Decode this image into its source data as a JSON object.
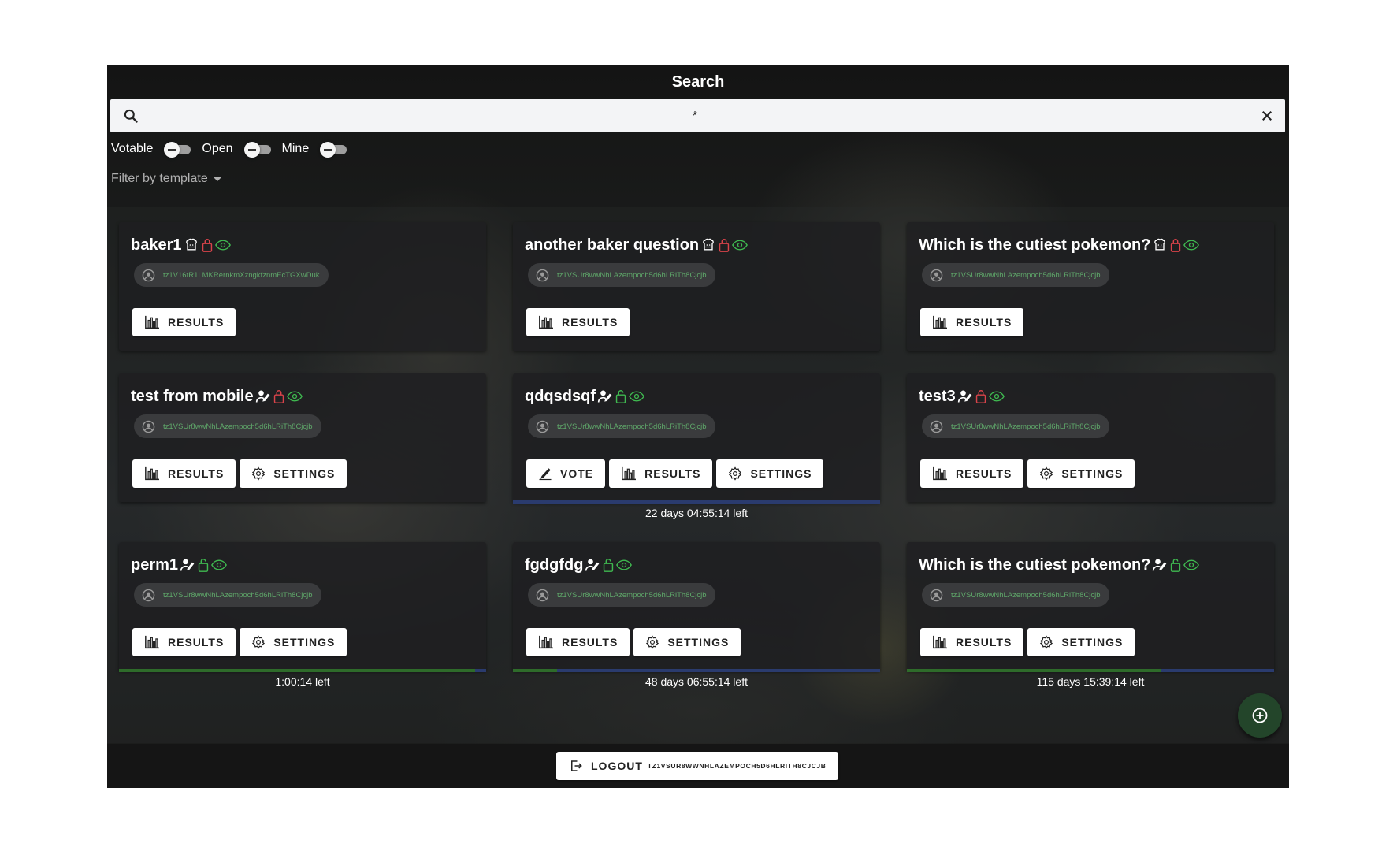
{
  "header": {
    "title": "Search"
  },
  "search": {
    "value": "*",
    "placeholder": ""
  },
  "filters": {
    "toggles": [
      {
        "label": "Votable",
        "checked": false
      },
      {
        "label": "Open",
        "checked": false
      },
      {
        "label": "Mine",
        "checked": false
      }
    ],
    "template_label": "Filter by template"
  },
  "buttons": {
    "vote": "VOTE",
    "results": "RESULTS",
    "settings": "SETTINGS"
  },
  "cards": [
    {
      "title": "baker1",
      "owner": "tz1V16tR1LMKRernkmXzngkfznmEcTGXwDuk",
      "type_icon": "baker-icon",
      "lock_icon": "lock-closed-icon"
    },
    {
      "title": "another baker question",
      "owner": "tz1VSUr8wwNhLAzempoch5d6hLRiTh8Cjcjb",
      "type_icon": "baker-icon",
      "lock_icon": "lock-closed-icon"
    },
    {
      "title": "Which is the cutiest pokemon?",
      "owner": "tz1VSUr8wwNhLAzempoch5d6hLRiTh8Cjcjb",
      "type_icon": "baker-icon",
      "lock_icon": "lock-closed-icon"
    },
    {
      "title": "test from mobile",
      "owner": "tz1VSUr8wwNhLAzempoch5d6hLRiTh8Cjcjb",
      "type_icon": "voter-icon",
      "lock_icon": "lock-closed-icon"
    },
    {
      "title": "qdqsdsqf",
      "owner": "tz1VSUr8wwNhLAzempoch5d6hLRiTh8Cjcjb",
      "type_icon": "voter-icon",
      "lock_icon": "lock-open-icon",
      "time_left": "22 days 04:55:14 left",
      "progress": 0
    },
    {
      "title": "test3",
      "owner": "tz1VSUr8wwNhLAzempoch5d6hLRiTh8Cjcjb",
      "type_icon": "voter-icon",
      "lock_icon": "lock-closed-icon"
    },
    {
      "title": "perm1",
      "owner": "tz1VSUr8wwNhLAzempoch5d6hLRiTh8Cjcjb",
      "type_icon": "voter-icon",
      "lock_icon": "lock-open-icon",
      "time_left": "1:00:14 left",
      "progress": 0.97
    },
    {
      "title": "fgdgfdg",
      "owner": "tz1VSUr8wwNhLAzempoch5d6hLRiTh8Cjcjb",
      "type_icon": "voter-icon",
      "lock_icon": "lock-open-icon",
      "time_left": "48 days 06:55:14 left",
      "progress": 0.12
    },
    {
      "title": "Which is the cutiest pokemon?",
      "owner": "tz1VSUr8wwNhLAzempoch5d6hLRiTh8Cjcjb",
      "type_icon": "voter-icon",
      "lock_icon": "lock-open-icon",
      "time_left": "115 days 15:39:14 left",
      "progress": 0.69
    }
  ],
  "footer": {
    "logout_label": "LOGOUT",
    "address": "TZ1VSUR8WWNHLAZEMPOCH5D6HLRITH8CJCJB"
  },
  "colors": {
    "lock_closed": "#d9434a",
    "lock_open": "#3fb950",
    "eye": "#3fb950",
    "address": "#5fa86a",
    "progress_done": "#2e6b2a",
    "progress_remaining": "#2a3b6e"
  }
}
